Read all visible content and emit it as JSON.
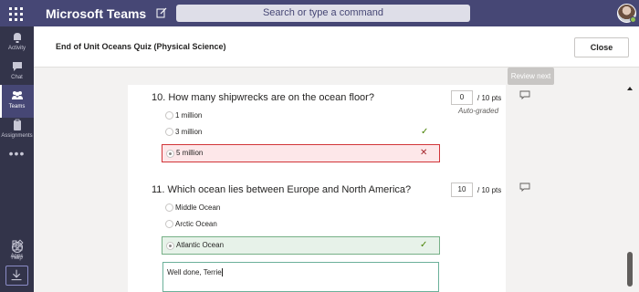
{
  "app": {
    "title": "Microsoft Teams"
  },
  "search": {
    "placeholder": "Search or type a command"
  },
  "rail": {
    "items": [
      {
        "label": "Activity",
        "icon": "bell-icon"
      },
      {
        "label": "Chat",
        "icon": "chat-icon"
      },
      {
        "label": "Teams",
        "icon": "teams-icon"
      },
      {
        "label": "Assignments",
        "icon": "assignments-icon"
      },
      {
        "label": "Apps",
        "icon": "apps-icon"
      },
      {
        "label": "Help",
        "icon": "help-icon"
      }
    ],
    "more": "•••"
  },
  "header": {
    "title": "End of Unit Oceans Quiz (Physical Science)",
    "close_label": "Close"
  },
  "review_next": "Review next",
  "questions": [
    {
      "title": "10. How many shipwrecks are on the ocean floor?",
      "options": [
        "1 million",
        "3 million",
        "5 million"
      ],
      "points_value": "0",
      "points_label": "/ 10 pts",
      "grading": "Auto-graded"
    },
    {
      "title": "11. Which ocean lies between Europe and North America?",
      "options": [
        "Middle Ocean",
        "Arctic Ocean",
        "Atlantic Ocean"
      ],
      "points_value": "10",
      "points_label": "/ 10 pts"
    }
  ],
  "feedback": {
    "text": "Well done, Terrie"
  },
  "colors": {
    "rail": "#33344a",
    "titlebar": "#464775",
    "correct": "#498205",
    "incorrect": "#d13438"
  }
}
